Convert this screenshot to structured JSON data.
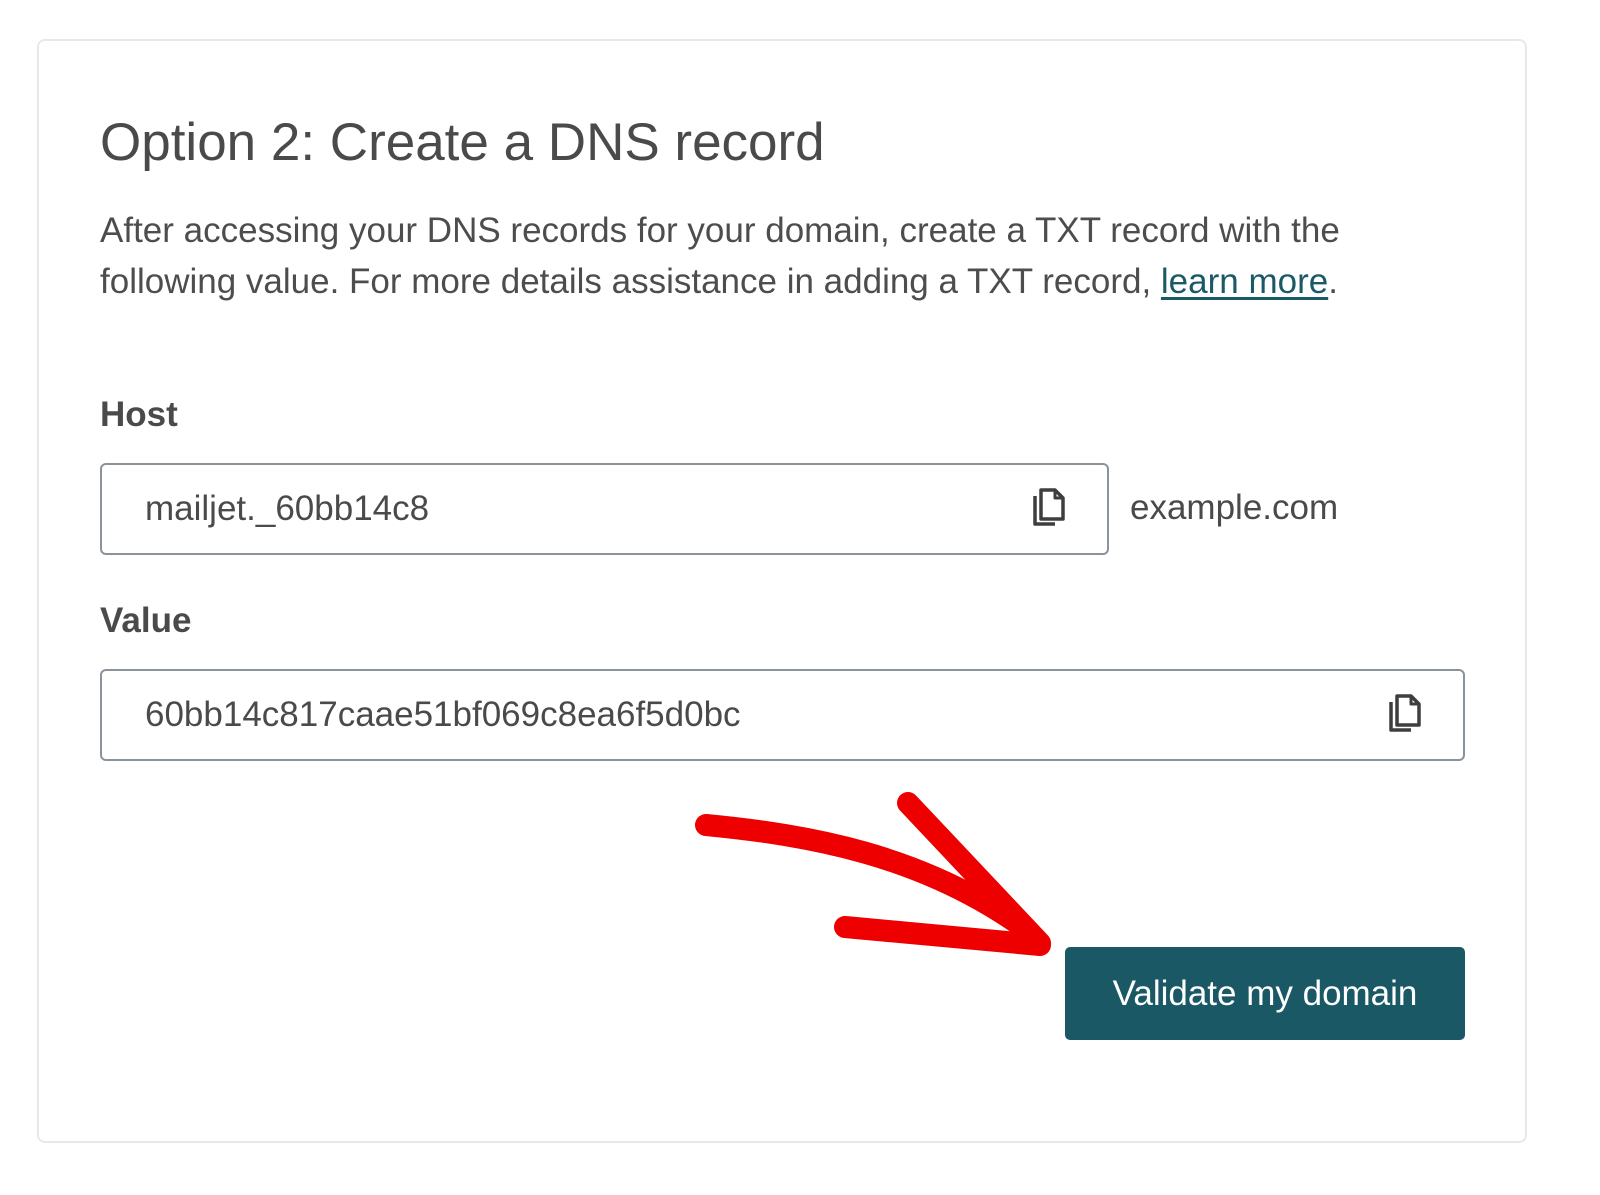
{
  "card": {
    "title": "Option 2: Create a DNS record",
    "description_text": "After accessing your DNS records for your domain, create a TXT record with the following value. For more details assistance in adding a TXT record, ",
    "learn_more_link": "learn more",
    "description_end": "."
  },
  "host": {
    "label": "Host",
    "value": "mailjet._60bb14c8",
    "domain_suffix": "example.com",
    "copy_icon": "copy-icon"
  },
  "value_field": {
    "label": "Value",
    "value": "60bb14c817caae51bf069c8ea6f5d0bc",
    "copy_icon": "copy-icon"
  },
  "actions": {
    "validate_label": "Validate my domain"
  },
  "colors": {
    "accent": "#1b5866",
    "link": "#1a5a66",
    "annotation_arrow": "#ee0000",
    "border": "#8a939c"
  }
}
